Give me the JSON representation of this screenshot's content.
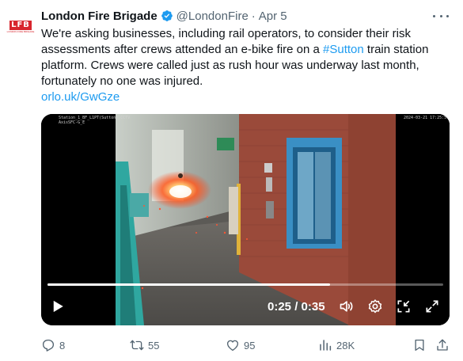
{
  "author": {
    "avatar_text": "LFB",
    "avatar_subtext": "LONDON FIRE BRIGADE",
    "display_name": "London Fire Brigade",
    "handle": "@LondonFire",
    "separator": "·",
    "date": "Apr 5"
  },
  "tweet": {
    "text_before_hashtag": "We're asking businesses, including rail operators, to consider their risk assessments after crews attended an e-bike fire on a ",
    "hashtag": "#Sutton",
    "text_after_hashtag": " train station platform. Crews were called just as rush hour was underway last month, fortunately no one was injured.",
    "link": "orlo.uk/GwGze"
  },
  "video": {
    "overlay_left": "Station_1_BF_L1PT(Sutton)_CCTV  ",
    "overlay_left_2": "AxisSFC-G_E",
    "overlay_right": "2024-03-21 17:25:51",
    "current_time": "0:25",
    "duration": "0:35",
    "time_separator": " / ",
    "progress_fraction": 0.714
  },
  "actions": {
    "replies": "8",
    "reposts": "55",
    "likes": "95",
    "views": "28K"
  },
  "colors": {
    "accent": "#1d9bf0",
    "muted": "#536471",
    "verified": "#1d9bf0",
    "brand_red": "#d8262e"
  },
  "icons": [
    "verified-icon",
    "more-icon",
    "play-icon",
    "volume-icon",
    "settings-icon",
    "pip-icon",
    "fullscreen-icon",
    "reply-icon",
    "repost-icon",
    "like-icon",
    "views-icon",
    "bookmark-icon",
    "share-icon"
  ]
}
